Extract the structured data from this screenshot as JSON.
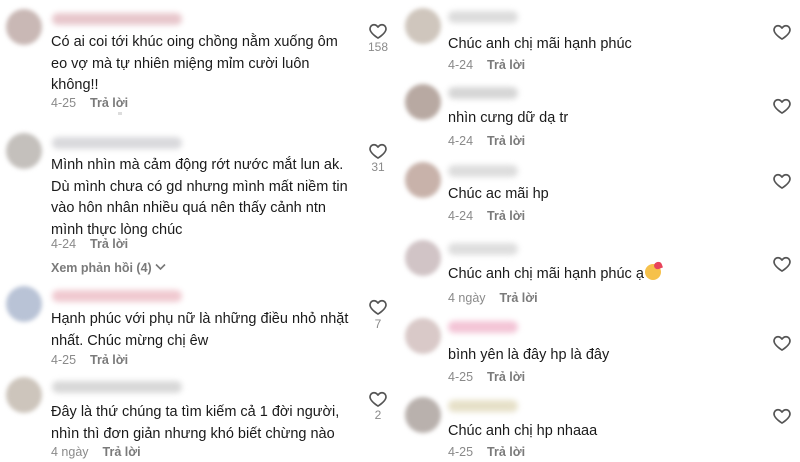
{
  "left_comments": [
    {
      "text": "Có ai coi tới khúc oing chồng nằm xuống ôm\neo vợ mà tự nhiên miệng mỉm cười luôn\nkhông!!",
      "date": "4-25",
      "reply": "Trả lời",
      "likes": "158",
      "avatar_color": "#c9b8b5",
      "name_color": "#e8c7cc"
    },
    {
      "text": "Mình nhìn mà cảm động rớt nước mắt lun ak.\nDù mình chưa có gd nhưng mình mất niềm tin\nvào hôn nhân nhiều quá nên thấy cảnh ntn\nmình thực lòng chúc",
      "date": "4-24",
      "reply": "Trả lời",
      "likes": "31",
      "view_replies": "Xem phản hồi (4)",
      "avatar_color": "#c4c0bc",
      "name_color": "#d9d9dc"
    },
    {
      "text": "Hạnh phúc với phụ nữ là những điều nhỏ nhặt\nnhất. Chúc mừng chị êw",
      "date": "4-25",
      "reply": "Trả lời",
      "likes": "7",
      "avatar_color": "#b9c3d6",
      "name_color": "#f0c9d0"
    },
    {
      "text": "Đây là thứ chúng ta tìm kiếm cả 1 đời người,\nnhìn thì đơn giản nhưng khó biết chừng nào",
      "date": "4 ngày",
      "reply": "Trả lời",
      "likes": "2",
      "avatar_color": "#cdc5bc",
      "name_color": "#d8d8d8"
    }
  ],
  "right_comments": [
    {
      "text": "Chúc anh chị mãi hạnh phúc",
      "date": "4-24",
      "reply": "Trả lời",
      "avatar_color": "#cfc6bd",
      "name_color": "#dcdcdc"
    },
    {
      "text": "nhìn cưng dữ dạ tr",
      "date": "4-24",
      "reply": "Trả lời",
      "avatar_color": "#b8a9a2",
      "name_color": "#d6d6d6"
    },
    {
      "text": "Chúc ac mãi hp",
      "date": "4-24",
      "reply": "Trả lời",
      "avatar_color": "#c8b2aa",
      "name_color": "#dddddd"
    },
    {
      "text": "Chúc anh chị mãi hạnh phúc ạ",
      "date": "4 ngày",
      "reply": "Trả lời",
      "avatar_color": "#d1c4c6",
      "name_color": "#dedede"
    },
    {
      "text": "bình yên là đây hp là đây",
      "date": "4-25",
      "reply": "Trả lời",
      "avatar_color": "#d9c9c8",
      "name_color": "#f3c4d6"
    },
    {
      "text": "Chúc anh chị hp nhaaa",
      "date": "4-25",
      "reply": "Trả lời",
      "avatar_color": "#b9b1ad",
      "name_color": "#e6e0c8"
    }
  ]
}
